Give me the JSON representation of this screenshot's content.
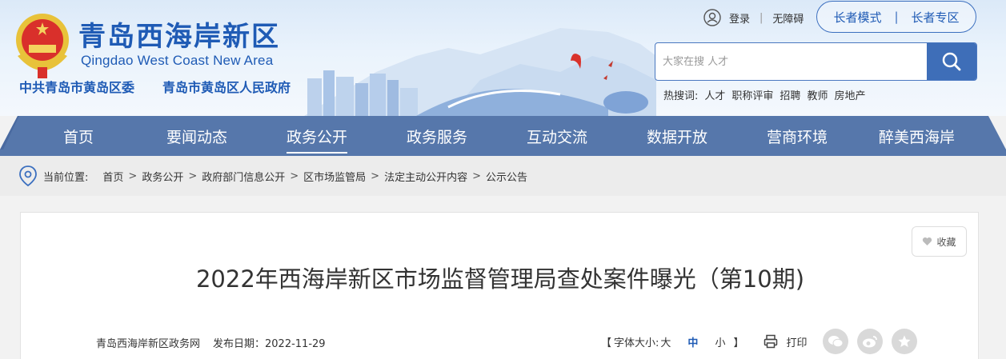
{
  "header": {
    "site_title": "青岛西海岸新区",
    "site_subtitle": "Qingdao West Coast New Area",
    "org_party": "中共青岛市黄岛区委",
    "org_gov": "青岛市黄岛区人民政府"
  },
  "user_bar": {
    "login": "登录",
    "separator": "|",
    "accessibility": "无障碍",
    "elder_mode": "长者模式",
    "elder_zone": "长者专区"
  },
  "search": {
    "placeholder": "大家在搜 人才",
    "hot_label": "热搜词:",
    "hot_words": [
      "人才",
      "职称评审",
      "招聘",
      "教师",
      "房地产"
    ]
  },
  "nav": {
    "items": [
      "首页",
      "要闻动态",
      "政务公开",
      "政务服务",
      "互动交流",
      "数据开放",
      "营商环境",
      "醉美西海岸"
    ],
    "active_index": 2
  },
  "breadcrumb": {
    "label": "当前位置:",
    "items": [
      "首页",
      "政务公开",
      "政府部门信息公开",
      "区市场监管局",
      "法定主动公开内容",
      "公示公告"
    ],
    "arrow": ">"
  },
  "article": {
    "favorite": "收藏",
    "title": "2022年西海岸新区市场监督管理局查处案件曝光（第10期)",
    "source": "青岛西海岸新区政务网",
    "date": "发布日期：2022-11-29",
    "font_size_label": "字体大小:",
    "bracket_open": "【",
    "bracket_close": "】",
    "size_large": "大",
    "size_medium": "中",
    "size_small": "小",
    "print": "打印"
  },
  "colors": {
    "brand_blue": "#1f5bb5",
    "nav_blue": "#5677ab",
    "search_button": "#3e6eb8"
  }
}
